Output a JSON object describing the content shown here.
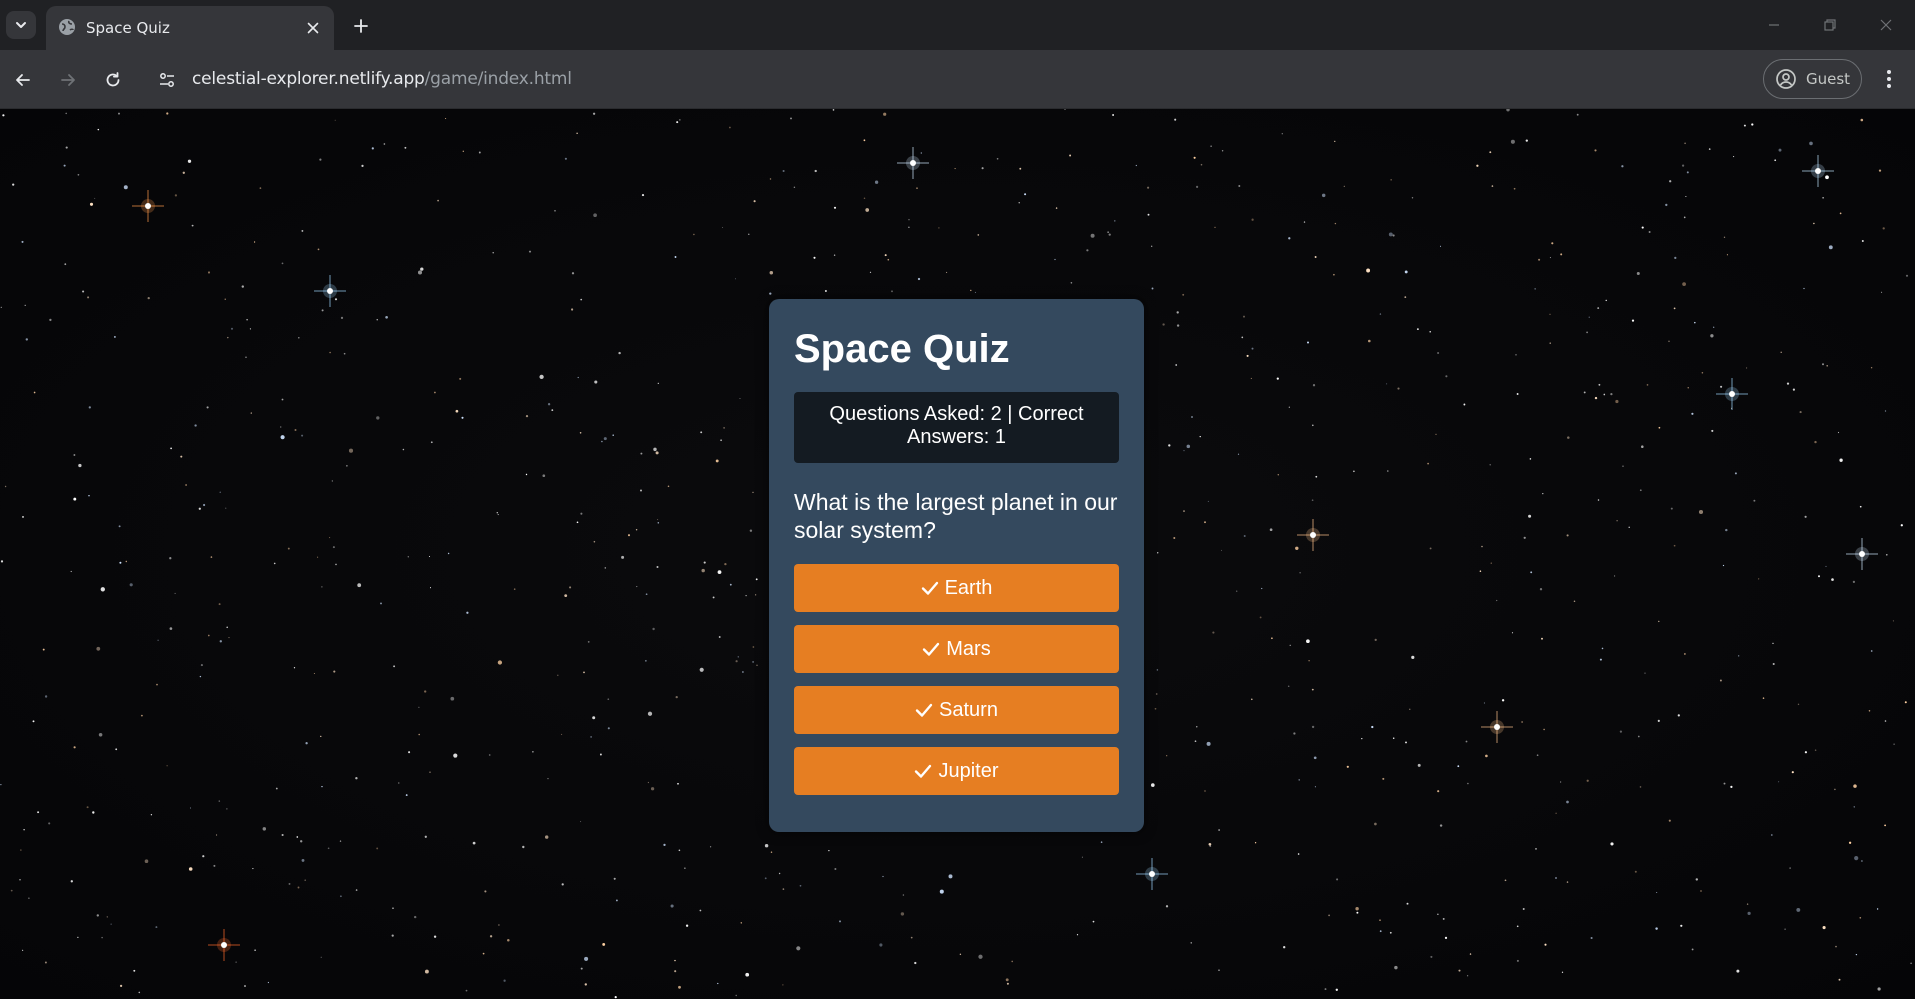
{
  "browser": {
    "tab_title": "Space Quiz",
    "url_host": "celestial-explorer.netlify.app",
    "url_path": "/game/index.html",
    "profile_label": "Guest"
  },
  "quiz": {
    "title": "Space Quiz",
    "score_text": "Questions Asked: 2 | Correct Answers: 1",
    "question": "What is the largest planet in our solar system?",
    "answers": [
      {
        "label": "Earth",
        "icon": "check-icon"
      },
      {
        "label": "Mars",
        "icon": "check-icon"
      },
      {
        "label": "Saturn",
        "icon": "check-icon"
      },
      {
        "label": "Jupiter",
        "icon": "check-icon"
      }
    ]
  },
  "colors": {
    "card_background": "#34495e",
    "score_background": "#141b22",
    "answer_button": "#e67e22"
  }
}
